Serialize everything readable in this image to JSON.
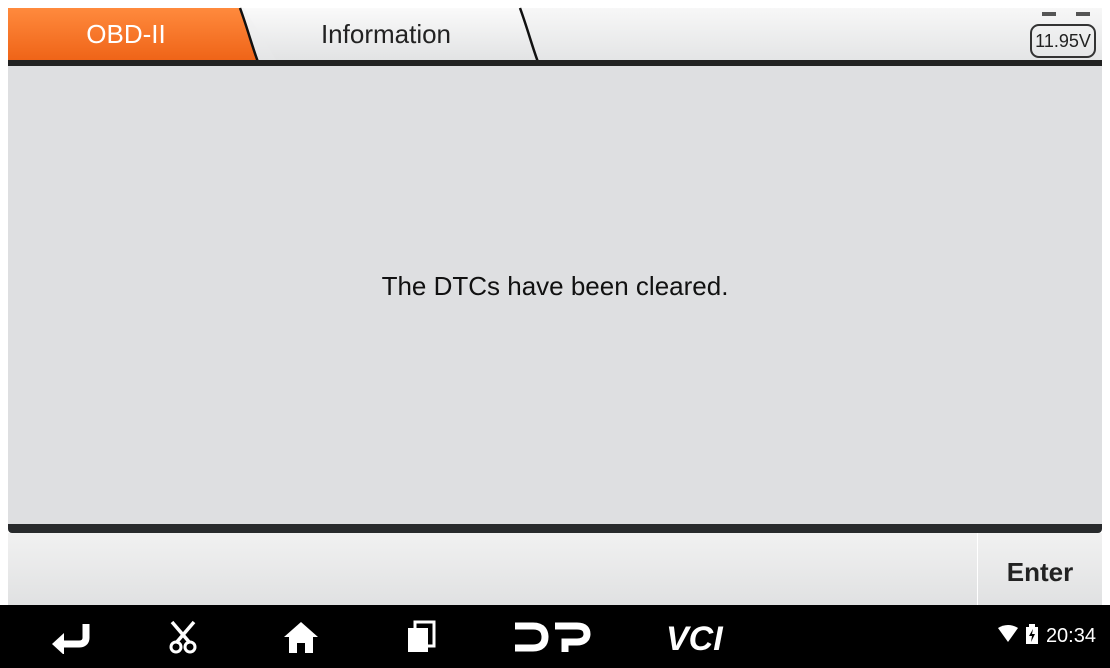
{
  "tabs": {
    "active_label": "OBD-II",
    "second_label": "Information"
  },
  "battery": {
    "voltage": "11.95V"
  },
  "content": {
    "message": "The DTCs have been cleared."
  },
  "actions": {
    "enter_label": "Enter"
  },
  "navbar": {
    "icons": [
      "back-icon",
      "scissors-icon",
      "home-icon",
      "recent-apps-icon",
      "dp-icon",
      "vci-icon"
    ],
    "dp_label": "DP",
    "vci_label": "VCI"
  },
  "status": {
    "time": "20:34",
    "icons": [
      "wifi-icon",
      "battery-charging-icon"
    ]
  },
  "colors": {
    "accent": "#f26b1d",
    "content_bg": "#dedfe1",
    "navbar_bg": "#000000"
  }
}
